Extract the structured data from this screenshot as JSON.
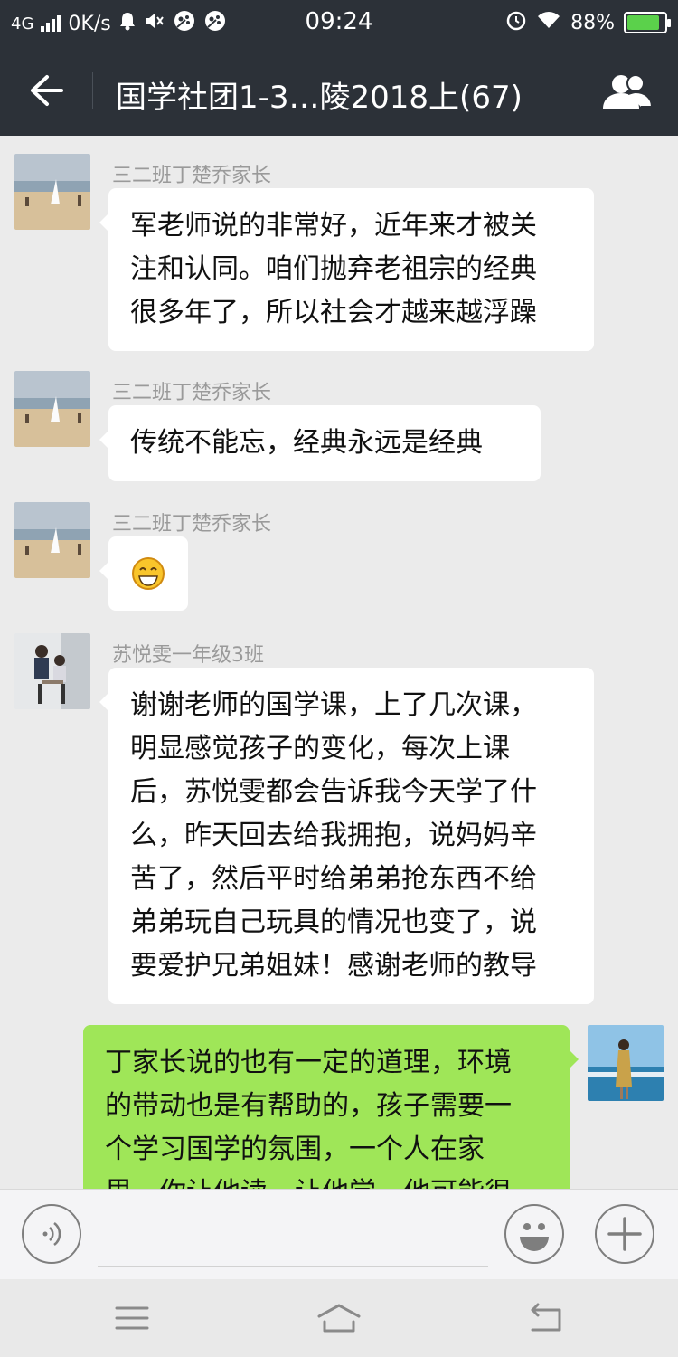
{
  "status_bar": {
    "network": "4G",
    "speed": "0K/s",
    "time": "09:24",
    "battery": "88%",
    "battery_level": 0.88,
    "battery_color": "#5bd14b"
  },
  "header": {
    "title": "国学社团1-3…陵2018上(67)",
    "back_icon": "arrow-left-icon",
    "group_icon": "group-members-icon"
  },
  "messages": [
    {
      "sender": "三二班丁楚乔家长",
      "lines": [
        "军老师说的非常好，近年来才被关",
        "注和认同。咱们抛弃老祖宗的经典",
        "很多年了，所以社会才越来越浮躁"
      ]
    },
    {
      "sender": "三二班丁楚乔家长",
      "lines": [
        "传统不能忘，经典永远是经典"
      ]
    },
    {
      "sender": "三二班丁楚乔家长",
      "emoji": "grinning-face-emoji"
    },
    {
      "sender": "苏悦雯一年级3班",
      "lines": [
        "谢谢老师的国学课，上了几次课，",
        "明显感觉孩子的变化，每次上课",
        "后，苏悦雯都会告诉我今天学了什",
        "么，昨天回去给我拥抱，说妈妈辛",
        "苦了，然后平时给弟弟抢东西不给",
        "弟弟玩自己玩具的情况也变了，说",
        "要爱护兄弟姐妹！感谢老师的教导"
      ]
    },
    {
      "self": true,
      "lines": [
        "丁家长说的也有一定的道理，环境",
        "的带动也是有帮助的，孩子需要一",
        "个学习国学的氛围，一个人在家",
        "里，你让他读，让他学，他可能很"
      ]
    }
  ],
  "colors": {
    "header_bg": "#2c3138",
    "chat_bg": "#ebebeb",
    "self_bubble": "#9fe658",
    "other_bubble": "#ffffff"
  }
}
